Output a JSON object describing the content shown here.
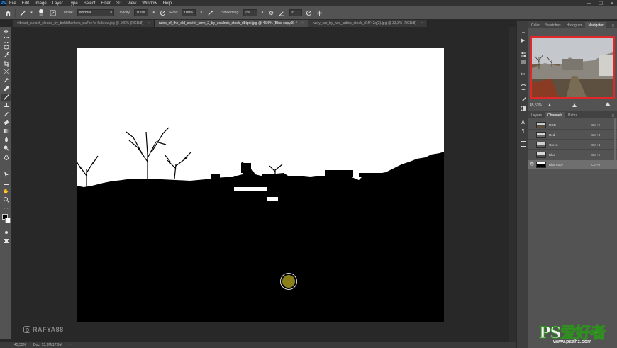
{
  "menubar": {
    "logo": "Ps",
    "items": [
      "File",
      "Edit",
      "Image",
      "Layer",
      "Type",
      "Select",
      "Filter",
      "3D",
      "View",
      "Window",
      "Help"
    ],
    "window_controls": [
      "—",
      "☐",
      "✕"
    ]
  },
  "options": {
    "brush_size": "100",
    "mode_label": "Mode:",
    "mode_value": "Normal",
    "opacity_label": "Opacity:",
    "opacity_value": "100%",
    "flow_label": "Flow:",
    "flow_value": "100%",
    "smoothing_label": "Smoothing:",
    "smoothing_value": "1%",
    "angle_value": "0°"
  },
  "tabs": [
    {
      "label": "vibrant_sunset_clouds_by_bolddhunters_da7he4e-fullview.jpg @ 100% (RGB/8)",
      "close": "×"
    },
    {
      "label": "ruins_of_the_old_soviet_farm_2_by_sowlmis_stock_d8tpni.jpg @ 45,5% (Blue copy/8) *",
      "close": "×"
    },
    {
      "label": "rusty_car_by_two_ladies_stock_d1f742q(2).jpg @ 33,3% (RGB/8)",
      "close": "×"
    }
  ],
  "status": {
    "zoom": "45,53%",
    "doc": "Doc: 13,9M/17,9M",
    "arrow": "›"
  },
  "watermark": "RAFYA88",
  "panels": {
    "top_tabs": [
      "Color",
      "Swatches",
      "Histogram",
      "Navigator"
    ],
    "active_top_tab": "Navigator",
    "navigator_zoom": "45,53%",
    "bottom_tabs": [
      "Layers",
      "Channels",
      "Paths"
    ],
    "active_bottom_tab": "Channels",
    "channels": [
      {
        "name": "RGB",
        "shortcut": "Ctrl+2",
        "visible": false,
        "selected": false
      },
      {
        "name": "Red",
        "shortcut": "Ctrl+3",
        "visible": false,
        "selected": false
      },
      {
        "name": "Green",
        "shortcut": "Ctrl+4",
        "visible": false,
        "selected": false
      },
      {
        "name": "Blue",
        "shortcut": "Ctrl+5",
        "visible": false,
        "selected": false
      },
      {
        "name": "Blue copy",
        "shortcut": "Ctrl+6",
        "visible": true,
        "selected": true
      }
    ],
    "menu_glyph": "≡"
  },
  "site_logo": {
    "main": "PS爱好者",
    "sub": "www.psahz.com"
  },
  "colors": {
    "accent_red": "#e0282b",
    "brush_fill": "#8b7f1a",
    "logo_green": "#2f8f1f"
  }
}
